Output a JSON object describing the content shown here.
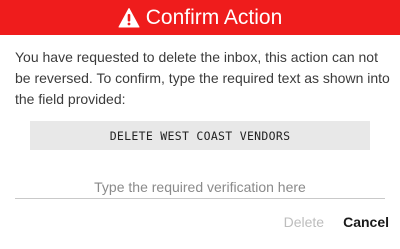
{
  "colors": {
    "header_background": "#ef1c1c",
    "header_text": "#ffffff",
    "code_box_background": "#e8e8e8",
    "delete_disabled": "#bdbdbd"
  },
  "dialog": {
    "title": "Confirm Action",
    "title_icon": "warning-triangle-icon",
    "message": "You have requested to delete the inbox, this action can not be reversed. To confirm, type the required text as shown into the field provided:",
    "required_text": "DELETE WEST COAST VENDORS",
    "input": {
      "placeholder": "Type the required verification here",
      "value": ""
    },
    "buttons": {
      "delete_label": "Delete",
      "delete_disabled": true,
      "cancel_label": "Cancel"
    }
  }
}
